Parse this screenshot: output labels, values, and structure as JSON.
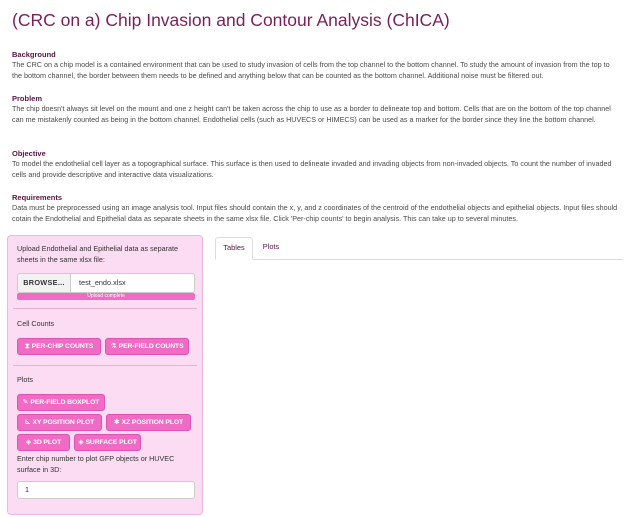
{
  "app": {
    "title": "(CRC on a) Chip Invasion and Contour Analysis (ChICA)"
  },
  "sections": {
    "background": {
      "heading": "Background",
      "text": "The CRC on a chip model is a contained environment that can be used to study invasion of cells from the top channel to the bottom channel. To study the amount of invasion from the top to the bottom channel, the border between them needs to be defined and anything below that can be counted as the bottom channel. Additional noise must be filtered out."
    },
    "problem": {
      "heading": "Problem",
      "text": "The chip doesn't always sit level on the mount and one z height can't be taken across the chip to use as a border to delineate top and bottom. Cells that are on the bottom of the top channel can me mistakenly counted as being in the bottom channel. Endothelial cells (such as HUVECS or HIMECS) can be used as a marker for the border since they line the bottom channel."
    },
    "objective": {
      "heading": "Objective",
      "text": "To model the endothelial cell layer as a topographical surface. This surface is then used to delineate invaded and invading objects from non-invaded objects. To count the number of invaded cells and provide descriptive and interactive data visualizations."
    },
    "requirements": {
      "heading": "Requirements",
      "text": "Data must be preprocessed using an image analysis tool. Input files should contain the x, y, and z coordinates of the centroid of the endothelial objects and epithelial objects. Input files should cotain the Endothelial and Epithelial data as separate sheets in the same xlsx file. Click 'Per-chip counts' to begin analysis. This can take up to several minutes."
    }
  },
  "sidebar": {
    "upload_label": "Upload Endothelial and Epithelial data as separate sheets in the same xlsx file:",
    "browse_label": "BROWSE...",
    "file_name": "test_endo.xlsx",
    "progress_text": "Upload complete",
    "progress_fraction": 1.0,
    "cell_counts_label": "Cell Counts",
    "per_chip_btn": "PER-CHIP COUNTS",
    "per_field_btn": "PER-FIELD COUNTS",
    "plots_label": "Plots",
    "boxplot_btn": "PER-FIELD BOXPLOT",
    "xy_btn": "XY POSITION PLOT",
    "xz_btn": "XZ POSITION PLOT",
    "plot3d_btn": "3D PLOT",
    "surface_btn": "SURFACE PLOT",
    "chip_number_label": "Enter chip number to plot GFP objects or HUVEC surface in 3D:",
    "chip_number_value": "1"
  },
  "main": {
    "tabs": [
      {
        "label": "Tables",
        "active": true
      },
      {
        "label": "Plots",
        "active": false
      }
    ]
  },
  "colors": {
    "title": "#7a1f5c",
    "accent": "#f06bc4",
    "sidebar_bg": "#fbdcf2"
  },
  "icons": {
    "per_chip": "hourglass-icon",
    "per_field": "flask-icon",
    "boxplot": "paintbrush-icon",
    "xy": "chart-icon",
    "xz": "asterisk-icon",
    "plot3d": "cube-icon",
    "surface": "cube-icon"
  }
}
